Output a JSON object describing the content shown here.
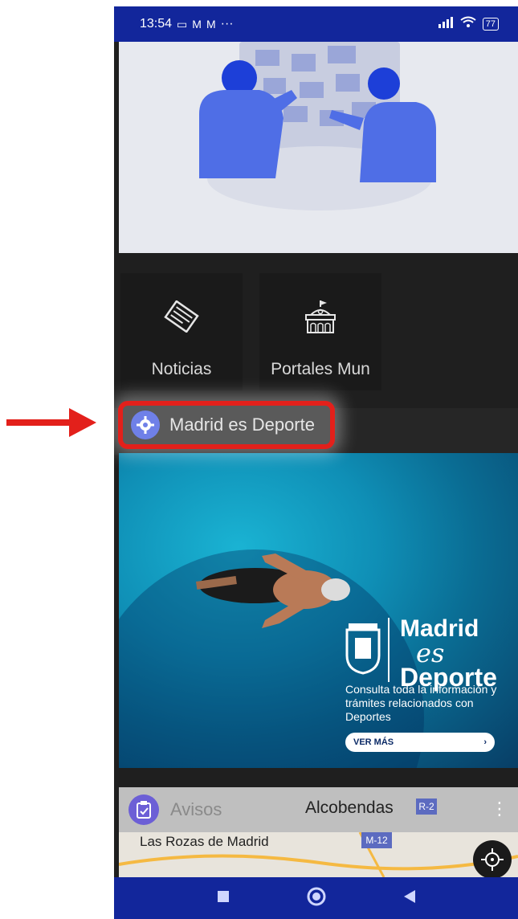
{
  "status_bar": {
    "time": "13:54",
    "notification_icons": [
      "vr-icon",
      "gmail-icon",
      "gmail-icon"
    ],
    "more": "···",
    "battery": "77"
  },
  "tiles": [
    {
      "label": "Noticias",
      "icon": "newspaper-icon"
    },
    {
      "label": "Portales Mun",
      "icon": "town-hall-icon"
    }
  ],
  "section": {
    "label": "Madrid es Deporte",
    "icon": "gear-icon"
  },
  "banner": {
    "madrid": "Madrid",
    "es": "es",
    "deporte": "Deporte",
    "description": "Consulta toda la información y trámites relacionados con Deportes",
    "cta": "VER MÁS"
  },
  "avisos": {
    "label": "Avisos",
    "icon": "clipboard-icon"
  },
  "map": {
    "alcobendas": "Alcobendas",
    "r2": "R-2",
    "las_rozas": "Las Rozas de Madrid",
    "m12": "M-12"
  },
  "colors": {
    "status_bar": "#12269b",
    "highlight": "#e3201b",
    "accent": "#6f80e8"
  }
}
